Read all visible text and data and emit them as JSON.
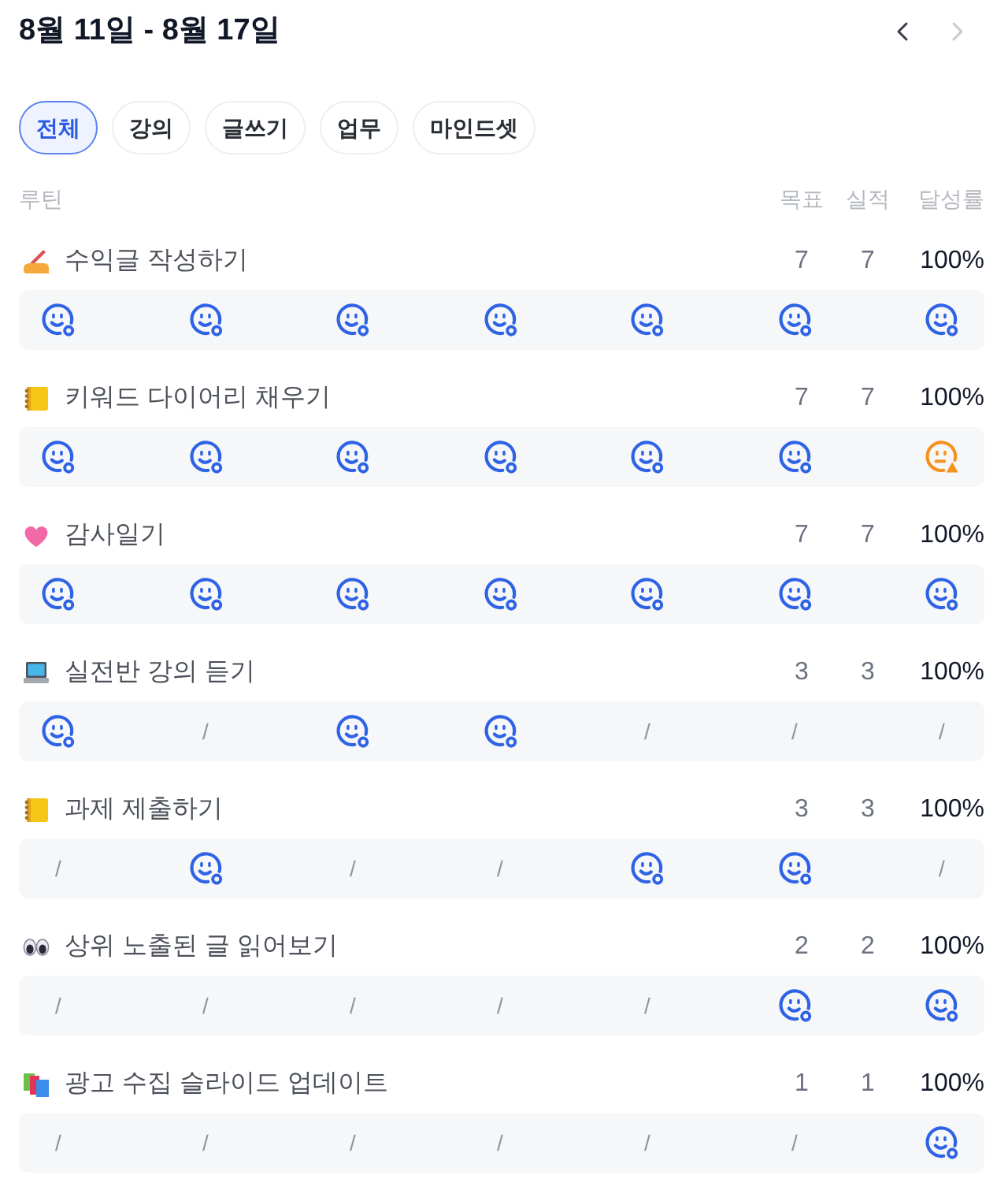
{
  "header": {
    "title": "8월 11일 - 8월 17일"
  },
  "nav": [
    {
      "kind": "prev",
      "disabled": false
    },
    {
      "kind": "next",
      "disabled": true
    }
  ],
  "tabs": [
    {
      "label": "전체",
      "selected": true
    },
    {
      "label": "강의",
      "selected": false
    },
    {
      "label": "글쓰기",
      "selected": false
    },
    {
      "label": "업무",
      "selected": false
    },
    {
      "label": "마인드셋",
      "selected": false
    }
  ],
  "columns": {
    "routine": "루틴",
    "goal": "목표",
    "actual": "실적",
    "rate": "달성률"
  },
  "routines": [
    {
      "kind": "writing",
      "name": "수익글 작성하기",
      "goal": "7",
      "actual": "7",
      "rate": "100%",
      "days": [
        {
          "kind": "done"
        },
        {
          "kind": "done"
        },
        {
          "kind": "done"
        },
        {
          "kind": "done"
        },
        {
          "kind": "done"
        },
        {
          "kind": "done"
        },
        {
          "kind": "done"
        }
      ]
    },
    {
      "kind": "notebook",
      "name": "키워드 다이어리 채우기",
      "goal": "7",
      "actual": "7",
      "rate": "100%",
      "days": [
        {
          "kind": "done"
        },
        {
          "kind": "done"
        },
        {
          "kind": "done"
        },
        {
          "kind": "done"
        },
        {
          "kind": "done"
        },
        {
          "kind": "done"
        },
        {
          "kind": "warning"
        }
      ]
    },
    {
      "kind": "heart",
      "name": "감사일기",
      "goal": "7",
      "actual": "7",
      "rate": "100%",
      "days": [
        {
          "kind": "done"
        },
        {
          "kind": "done"
        },
        {
          "kind": "done"
        },
        {
          "kind": "done"
        },
        {
          "kind": "done"
        },
        {
          "kind": "done"
        },
        {
          "kind": "done"
        }
      ]
    },
    {
      "kind": "laptop",
      "name": "실전반 강의 듣기",
      "goal": "3",
      "actual": "3",
      "rate": "100%",
      "days": [
        {
          "kind": "done"
        },
        {
          "kind": "rest",
          "text": "/"
        },
        {
          "kind": "done"
        },
        {
          "kind": "done"
        },
        {
          "kind": "rest",
          "text": "/"
        },
        {
          "kind": "rest",
          "text": "/"
        },
        {
          "kind": "rest",
          "text": "/"
        }
      ]
    },
    {
      "kind": "notebook",
      "name": "과제 제출하기",
      "goal": "3",
      "actual": "3",
      "rate": "100%",
      "days": [
        {
          "kind": "rest",
          "text": "/"
        },
        {
          "kind": "done"
        },
        {
          "kind": "rest",
          "text": "/"
        },
        {
          "kind": "rest",
          "text": "/"
        },
        {
          "kind": "done"
        },
        {
          "kind": "done"
        },
        {
          "kind": "rest",
          "text": "/"
        }
      ]
    },
    {
      "kind": "eyes",
      "name": "상위 노출된 글 읽어보기",
      "goal": "2",
      "actual": "2",
      "rate": "100%",
      "days": [
        {
          "kind": "rest",
          "text": "/"
        },
        {
          "kind": "rest",
          "text": "/"
        },
        {
          "kind": "rest",
          "text": "/"
        },
        {
          "kind": "rest",
          "text": "/"
        },
        {
          "kind": "rest",
          "text": "/"
        },
        {
          "kind": "done"
        },
        {
          "kind": "done"
        }
      ]
    },
    {
      "kind": "books",
      "name": "광고 수집 슬라이드 업데이트",
      "goal": "1",
      "actual": "1",
      "rate": "100%",
      "days": [
        {
          "kind": "rest",
          "text": "/"
        },
        {
          "kind": "rest",
          "text": "/"
        },
        {
          "kind": "rest",
          "text": "/"
        },
        {
          "kind": "rest",
          "text": "/"
        },
        {
          "kind": "rest",
          "text": "/"
        },
        {
          "kind": "rest",
          "text": "/"
        },
        {
          "kind": "done"
        }
      ]
    }
  ]
}
